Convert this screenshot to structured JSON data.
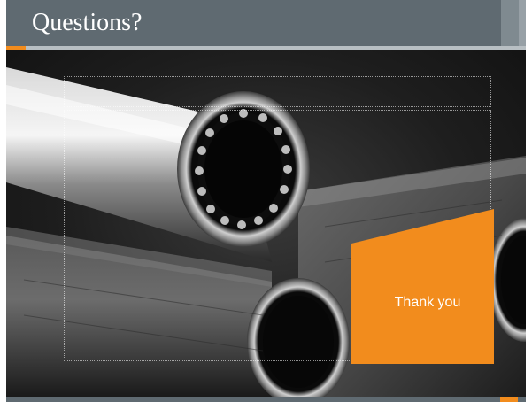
{
  "slide": {
    "title": "Questions?",
    "callout_text": "Thank you"
  },
  "colors": {
    "title_band": "#5f6a71",
    "accent": "#f28c1d",
    "callout": "#f28c1d",
    "text": "#ffffff"
  },
  "image": {
    "subject_icon": "steel-pipes-photo"
  }
}
